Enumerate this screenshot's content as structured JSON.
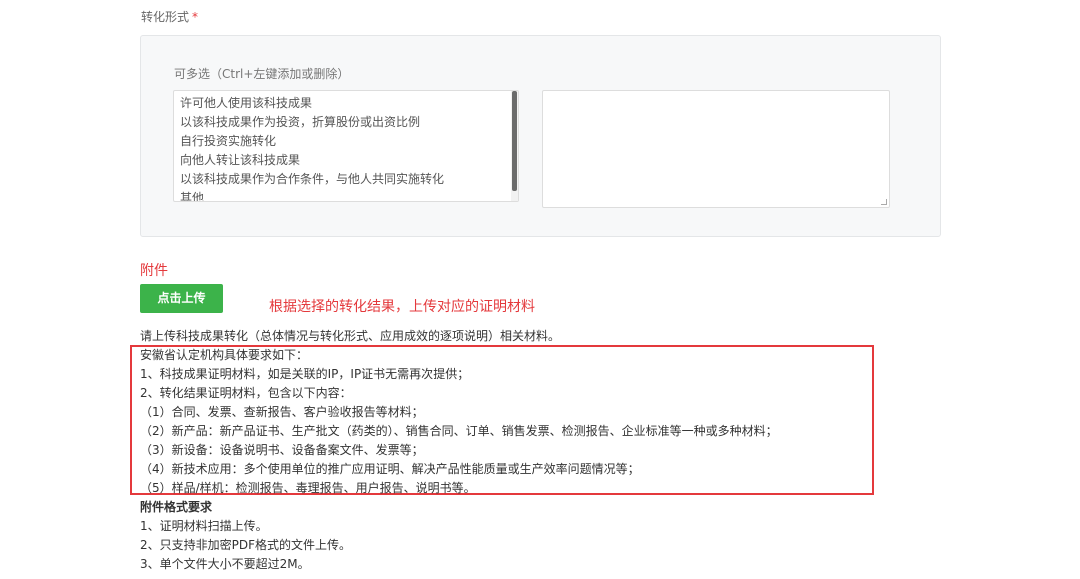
{
  "field": {
    "label": "转化形式",
    "required_mark": "*"
  },
  "panel": {
    "hint": "可多选（Ctrl+左键添加或删除）",
    "options": [
      "许可他人使用该科技成果",
      "以该科技成果作为投资，折算股份或出资比例",
      "自行投资实施转化",
      "向他人转让该科技成果",
      "以该科技成果作为合作条件，与他人共同实施转化",
      "其他"
    ],
    "selected_value": ""
  },
  "attachment": {
    "title": "附件",
    "upload_label": "点击上传",
    "annotation": "根据选择的转化结果，上传对应的证明材料",
    "description": "请上传科技成果转化（总体情况与转化形式、应用成效的逐项说明）相关材料。"
  },
  "requirements": [
    "安徽省认定机构具体要求如下：",
    "1、科技成果证明材料，如是关联的IP，IP证书无需再次提供；",
    "2、转化结果证明材料，包含以下内容：",
    "（1）合同、发票、查新报告、客户验收报告等材料；",
    "（2）新产品：新产品证书、生产批文（药类的）、销售合同、订单、销售发票、检测报告、企业标准等一种或多种材料；",
    "（3）新设备：设备说明书、设备备案文件、发票等；",
    "（4）新技术应用：多个使用单位的推广应用证明、解决产品性能质量或生产效率问题情况等；",
    "（5）样品/样机：检测报告、毒理报告、用户报告、说明书等。"
  ],
  "format": {
    "heading": "附件格式要求",
    "items": [
      "1、证明材料扫描上传。",
      "2、只支持非加密PDF格式的文件上传。",
      "3、单个文件大小不要超过2M。"
    ]
  },
  "colors": {
    "accent_red": "#e4393c",
    "button_green": "#3cb34a",
    "panel_bg": "#f7f8f9"
  }
}
